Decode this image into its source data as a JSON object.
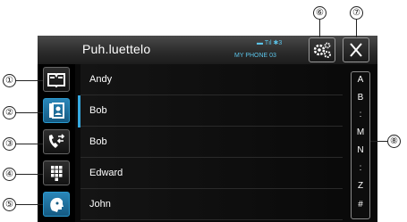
{
  "header": {
    "title": "Puh.luettelo",
    "status_text": "▬ Tıl ✱3",
    "phone_name": "MY PHONE 03"
  },
  "contacts": [
    "Andy",
    "Bob",
    "Bob",
    "Edward",
    "John"
  ],
  "alphabet_index": [
    "A",
    "B",
    ":",
    "M",
    "N",
    ":",
    "Z",
    "#"
  ],
  "callouts": {
    "c1": "①",
    "c2": "②",
    "c3": "③",
    "c4": "④",
    "c5": "⑤",
    "c6": "⑥",
    "c7": "⑦",
    "c8": "⑧"
  },
  "colors": {
    "accent": "#36a9e0",
    "status_text": "#5bc3e8",
    "background": "#0a0a0a"
  },
  "icons": [
    "phonebook-icon",
    "contacts-icon",
    "call-history-icon",
    "keypad-icon",
    "voice-recognition-icon",
    "settings-icon",
    "close-icon"
  ]
}
